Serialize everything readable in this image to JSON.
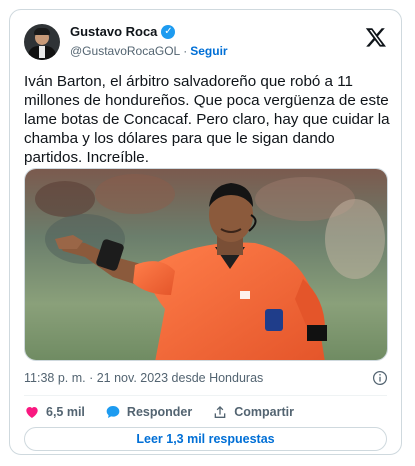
{
  "author": {
    "name": "Gustavo Roca",
    "handle": "@GustavoRocaGOL",
    "separator": "·",
    "follow_label": "Seguir",
    "verified_color": "#1d9bf0"
  },
  "tweet": {
    "text": "Iván Barton, el árbitro salvadoreño que robó a 11 millones de hondureños. Que poca vergüenza de este lame botas de Concacaf. Pero claro, hay que cuidar la chamba y los dólares para que le sigan dando partidos. Increíble.",
    "timestamp": "11:38 p. m. · 21 nov. 2023 desde Honduras"
  },
  "actions": {
    "likes": "6,5 mil",
    "reply_label": "Responder",
    "share_label": "Compartir"
  },
  "replies_button": "Leer 1,3 mil respuestas",
  "icons": {
    "logo": "x-logo-icon",
    "info": "info-icon",
    "like": "heart-icon",
    "reply": "reply-bubble-icon",
    "share": "share-icon"
  },
  "colors": {
    "link": "#006fd6",
    "like": "#f91880",
    "reply": "#1d9bf0",
    "jersey": "#f36b3a"
  }
}
